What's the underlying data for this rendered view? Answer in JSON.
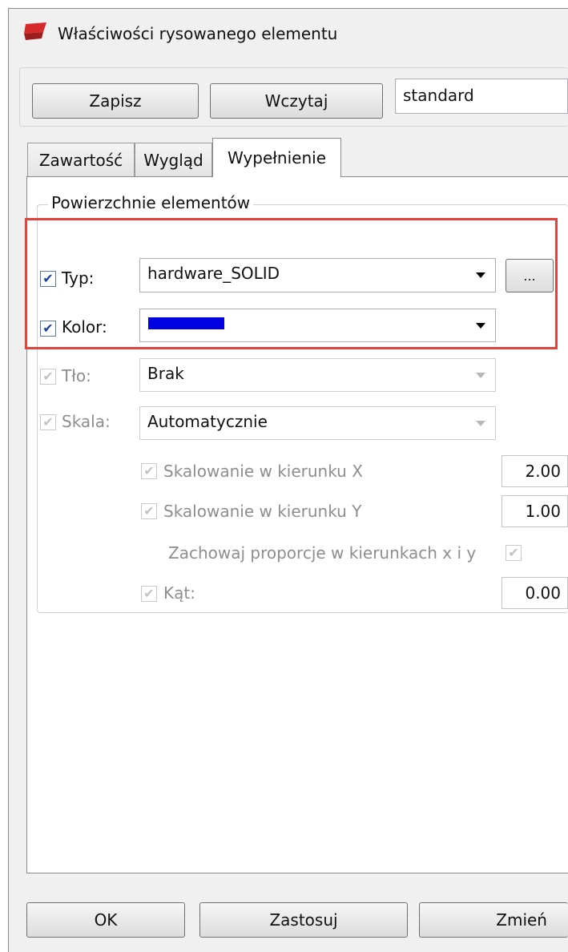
{
  "window": {
    "title": "Właściwości rysowanego elementu",
    "icon": "app-icon"
  },
  "toolbar": {
    "save_label": "Zapisz",
    "load_label": "Wczytaj",
    "preset_value": "standard"
  },
  "tabs": [
    {
      "label": "Zawartość",
      "active": false
    },
    {
      "label": "Wygląd",
      "active": false
    },
    {
      "label": "Wypełnienie",
      "active": true
    }
  ],
  "group": {
    "title": "Powierzchnie elementów",
    "type": {
      "label": "Typ:",
      "checked": true,
      "value": "hardware_SOLID",
      "browse_label": "..."
    },
    "color": {
      "label": "Kolor:",
      "checked": true,
      "value": "#0000e0"
    },
    "background": {
      "label": "Tło:",
      "checked": true,
      "enabled": false,
      "value": "Brak"
    },
    "scale": {
      "label": "Skala:",
      "checked": true,
      "enabled": false,
      "value": "Automatycznie"
    },
    "scale_x": {
      "label": "Skalowanie w kierunku X",
      "value": "2.00"
    },
    "scale_y": {
      "label": "Skalowanie w kierunku Y",
      "value": "1.00"
    },
    "keep_ratio": {
      "label": "Zachowaj proporcje w kierunkach x i y"
    },
    "angle": {
      "label": "Kąt:",
      "value": "0.00"
    }
  },
  "footer": {
    "ok_label": "OK",
    "apply_label": "Zastosuj",
    "change_label": "Zmień"
  },
  "colors": {
    "highlight": "#e0443b",
    "accent": "#1c3f9c",
    "swatch": "#0000e0"
  }
}
